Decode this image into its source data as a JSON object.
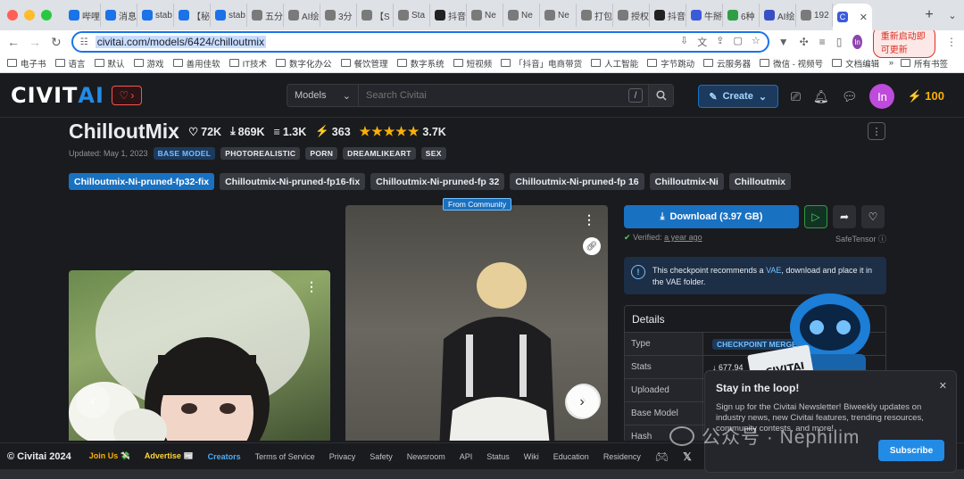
{
  "browser": {
    "tabs": [
      {
        "label": "哔哩",
        "fav_color": "#1a73e8"
      },
      {
        "label": "消息",
        "fav_color": "#1a73e8"
      },
      {
        "label": "stab",
        "fav_color": "#1a73e8"
      },
      {
        "label": "【秘",
        "fav_color": "#1a73e8"
      },
      {
        "label": "stab",
        "fav_color": "#1a73e8"
      },
      {
        "label": "五分",
        "fav_color": "#7a7a7a"
      },
      {
        "label": "AI绘",
        "fav_color": "#7a7a7a"
      },
      {
        "label": "3分",
        "fav_color": "#7a7a7a"
      },
      {
        "label": "【S",
        "fav_color": "#7a7a7a"
      },
      {
        "label": "Sta",
        "fav_color": "#7a7a7a"
      },
      {
        "label": "抖音",
        "fav_color": "#222"
      },
      {
        "label": "Ne",
        "fav_color": "#7a7a7a"
      },
      {
        "label": "Ne",
        "fav_color": "#7a7a7a"
      },
      {
        "label": "Ne",
        "fav_color": "#7a7a7a"
      },
      {
        "label": "打包",
        "fav_color": "#7a7a7a"
      },
      {
        "label": "授权",
        "fav_color": "#7a7a7a"
      },
      {
        "label": "抖音",
        "fav_color": "#222"
      },
      {
        "label": "牛掰",
        "fav_color": "#3b5bdb"
      },
      {
        "label": "6种",
        "fav_color": "#2f9e44"
      },
      {
        "label": "AI绘",
        "fav_color": "#364fc7"
      },
      {
        "label": "192",
        "fav_color": "#7a7a7a"
      }
    ],
    "active_tab_fav": "C",
    "url": "civitai.com/models/6424/chilloutmix",
    "restart_label": "重新启动即可更新",
    "profile_initial": "In",
    "bookmarks": [
      "电子书",
      "语言",
      "默认",
      "游戏",
      "善用佳软",
      "IT技术",
      "数字化办公",
      "餐饮管理",
      "数字系统",
      "短视频",
      "「抖音」电商带货",
      "人工智能",
      "字节跳动",
      "云服务器",
      "微信 - 视频号",
      "文档编辑"
    ],
    "bookmarks_more": "»",
    "all_bookmarks": "所有书签"
  },
  "header": {
    "logo_a": "CIVIT",
    "logo_b": "AI",
    "search_scope": "Models",
    "search_placeholder": "Search Civitai",
    "slash": "/",
    "create_label": "Create",
    "user_initial": "In",
    "buzz": "100"
  },
  "model": {
    "title": "ChilloutMix",
    "likes": "72K",
    "downloads": "869K",
    "comments": "1.3K",
    "buzz": "363",
    "rating_count": "3.7K",
    "stars": "★★★★★",
    "updated": "Updated: May 1, 2023",
    "base_badge": "BASE MODEL",
    "tags": [
      "PHOTOREALISTIC",
      "PORN",
      "DREAMLIKEART",
      "SEX"
    ],
    "versions": [
      "Chilloutmix-Ni-pruned-fp32-fix",
      "Chilloutmix-Ni-pruned-fp16-fix",
      "Chilloutmix-Ni-pruned-fp 32",
      "Chilloutmix-Ni-pruned-fp 16",
      "Chilloutmix-Ni",
      "Chilloutmix"
    ],
    "from_community": "From Community"
  },
  "side": {
    "download_label": "Download (3.97 GB)",
    "verified_prefix": "Verified:",
    "verified_when": "a year ago",
    "format": "SafeTensor",
    "vae_before": "This checkpoint recommends a",
    "vae_link": "VAE",
    "vae_after": ", download and place it in the VAE folder.",
    "details_title": "Details",
    "rows": [
      {
        "k": "Type",
        "v": "CHECKPOINT MERGE"
      },
      {
        "k": "Stats",
        "v": "↓ 677,94"
      },
      {
        "k": "Uploaded",
        "v": ""
      },
      {
        "k": "Base Model",
        "v": ""
      },
      {
        "k": "Hash",
        "v": ""
      }
    ]
  },
  "newsletter": {
    "title": "Stay in the loop!",
    "body": "Sign up for the Civitai Newsletter! Biweekly updates on industry news, new Civitai features, trending resources, community contests, and more!",
    "button": "Subscribe"
  },
  "watermark": "公众号 · Nephilim",
  "footer": {
    "copyright": "© Civitai 2024",
    "join": "Join Us 💸",
    "advertise": "Advertise 📰",
    "creators": "Creators",
    "links": [
      "Terms of Service",
      "Privacy",
      "Safety",
      "Newsroom",
      "API",
      "Status",
      "Wiki",
      "Education",
      "Residency"
    ]
  },
  "colors": {
    "accent": "#1971c2",
    "buzz": "#fab005",
    "bg": "#1a1b1e"
  }
}
